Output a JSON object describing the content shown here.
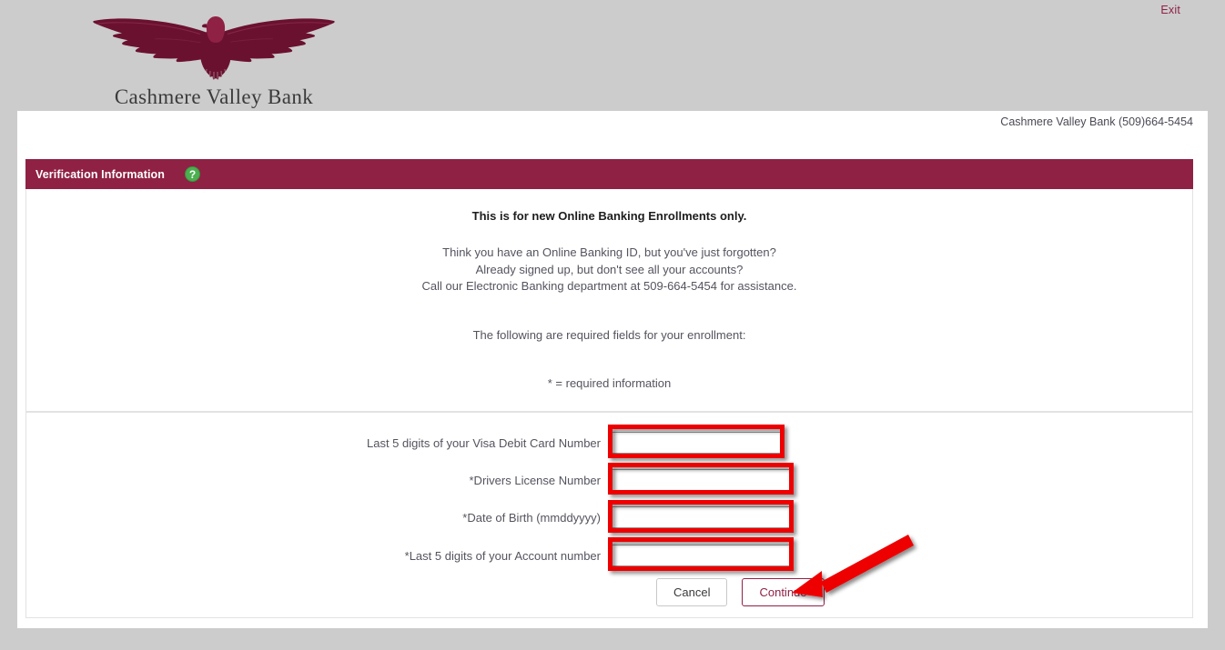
{
  "topbar": {
    "exit_label": "Exit"
  },
  "brand": {
    "logo_icon": "eagle-logo-icon",
    "name": "Cashmere Valley Bank",
    "logo_color": "#6b1130",
    "logo_head_color": "#8F2144"
  },
  "panel": {
    "contact_line": "Cashmere Valley Bank (509)664-5454"
  },
  "section": {
    "title": "Verification Information",
    "help_icon": "help-question-icon",
    "help_glyph": "?",
    "header_color": "#8F2144"
  },
  "info": {
    "lead": "This is for new Online Banking Enrollments only.",
    "lines": [
      "Think you have an Online Banking ID, but you've just forgotten?",
      "Already signed up, but don't see all your accounts?",
      "Call our Electronic Banking department at 509-664-5454 for assistance."
    ],
    "required_lead": "The following are required fields for your enrollment:",
    "required_key": "* = required information"
  },
  "form": {
    "fields": [
      {
        "label": "Last 5 digits of your Visa Debit Card Number",
        "value": "",
        "placeholder": "",
        "name": "visa-debit-card-last5-field",
        "required": false
      },
      {
        "label": "*Drivers License Number",
        "value": "",
        "placeholder": "",
        "name": "drivers-license-number-field",
        "required": true
      },
      {
        "label": "*Date of Birth (mmddyyyy)",
        "value": "",
        "placeholder": "",
        "name": "date-of-birth-field",
        "required": true
      },
      {
        "label": "*Last 5 digits of your Account number",
        "value": "",
        "placeholder": "",
        "name": "account-number-last5-field",
        "required": true
      }
    ],
    "cancel_label": "Cancel",
    "continue_label": "Continue"
  },
  "annotations": {
    "color": "#ee0000",
    "arrow_target": "continue-button",
    "boxes": [
      {
        "name": "visa-debit-card-last5-field"
      },
      {
        "name": "drivers-license-number-field"
      },
      {
        "name": "date-of-birth-field"
      },
      {
        "name": "account-number-last5-field"
      }
    ]
  }
}
